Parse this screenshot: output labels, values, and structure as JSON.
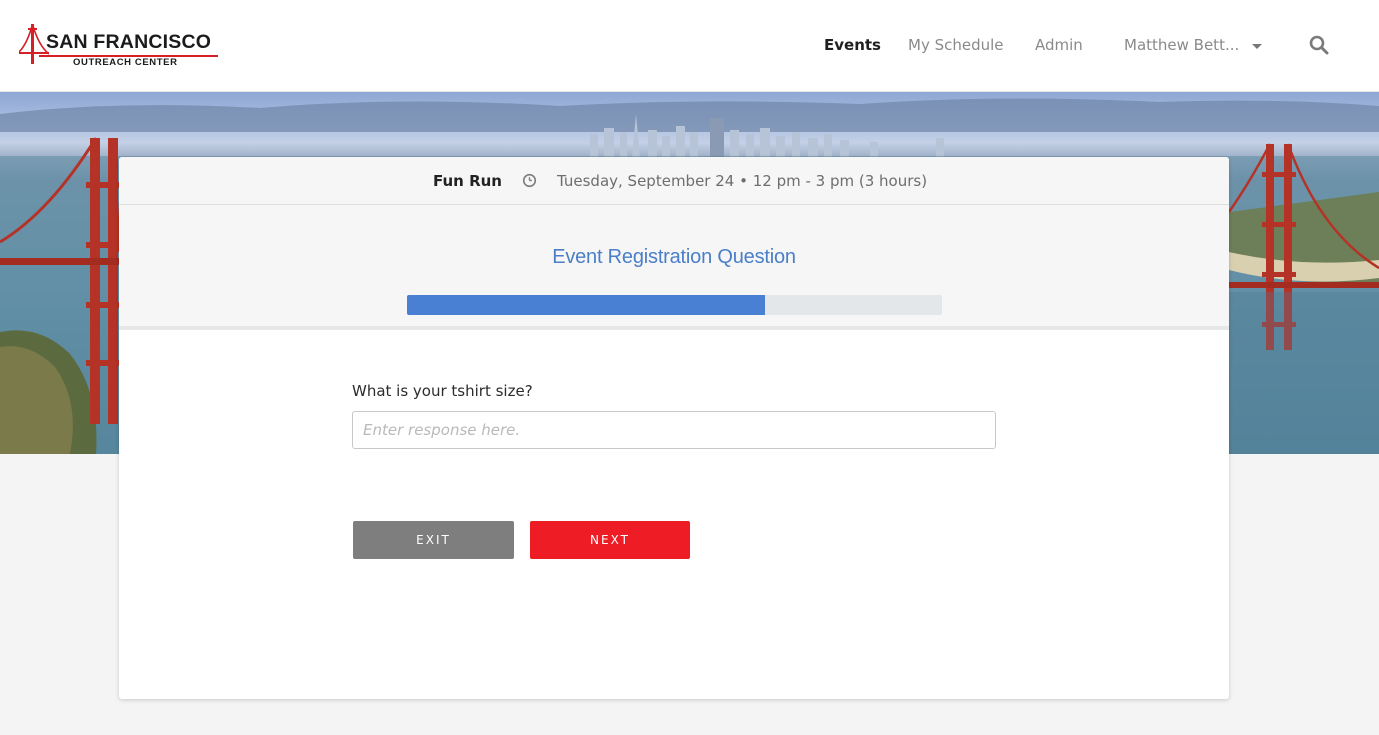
{
  "header": {
    "logo": {
      "title": "San Francisco",
      "subtitle": "Outreach Center"
    },
    "nav": [
      {
        "label": "Events",
        "active": true
      },
      {
        "label": "My Schedule",
        "active": false
      },
      {
        "label": "Admin",
        "active": false
      }
    ],
    "user": {
      "label": "Matthew Bett..."
    },
    "search_icon": "search-icon"
  },
  "event": {
    "name": "Fun Run",
    "time_icon": "clock-icon",
    "datetime": "Tuesday, September 24 • 12 pm - 3 pm (3 hours)"
  },
  "registration": {
    "title": "Event Registration Question",
    "progress_percent": 67,
    "question": "What is your tshirt size?",
    "answer_value": "",
    "answer_placeholder": "Enter response here."
  },
  "actions": {
    "exit_label": "EXIT",
    "next_label": "NEXT"
  },
  "colors": {
    "accent_blue": "#4a80d4",
    "brand_red": "#ee1c25",
    "exit_gray": "#7e7e7e"
  }
}
